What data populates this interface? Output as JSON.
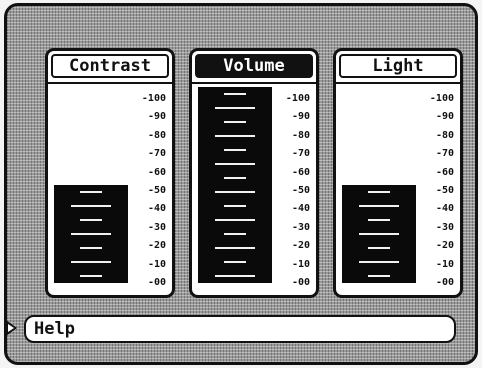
{
  "panels": [
    {
      "key": "contrast",
      "label": "Contrast",
      "selected": false,
      "level": 50,
      "ticks": [
        "100",
        "90",
        "80",
        "70",
        "60",
        "50",
        "40",
        "30",
        "20",
        "10",
        "00"
      ]
    },
    {
      "key": "volume",
      "label": "Volume",
      "selected": true,
      "level": 100,
      "ticks": [
        "100",
        "90",
        "80",
        "70",
        "60",
        "50",
        "40",
        "30",
        "20",
        "10",
        "00"
      ]
    },
    {
      "key": "light",
      "label": "Light",
      "selected": false,
      "level": 50,
      "ticks": [
        "100",
        "90",
        "80",
        "70",
        "60",
        "50",
        "40",
        "30",
        "20",
        "10",
        "00"
      ]
    }
  ],
  "help": {
    "label": "Help"
  },
  "colors": {
    "bar": "#0a0a0a",
    "frame": "#111111",
    "background": "#9a9a9a"
  }
}
